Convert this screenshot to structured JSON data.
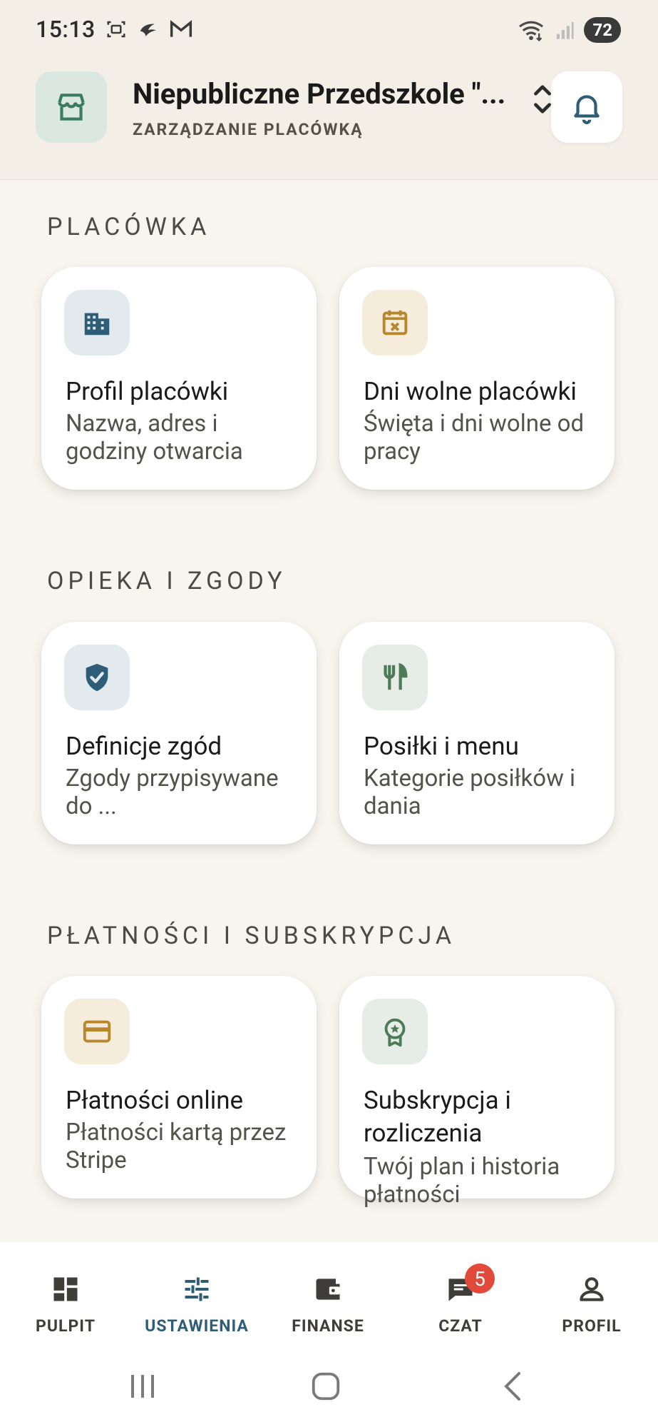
{
  "status_bar": {
    "time": "15:13",
    "battery": "72"
  },
  "header": {
    "institution_name": "Niepubliczne Przedszkole \"...",
    "subtitle": "ZARZĄDZANIE PLACÓWKĄ"
  },
  "sections": [
    {
      "title": "PLACÓWKA",
      "cards": [
        {
          "title": "Profil placówki",
          "desc": "Nazwa, adres i godziny otwarcia",
          "icon": "building-icon"
        },
        {
          "title": "Dni wolne placówki",
          "desc": "Święta i dni wolne od pracy",
          "icon": "calendar-x-icon"
        }
      ]
    },
    {
      "title": "OPIEKA I ZGODY",
      "cards": [
        {
          "title": "Definicje zgód",
          "desc": "Zgody przypisywane do ...",
          "icon": "shield-check-icon"
        },
        {
          "title": "Posiłki i menu",
          "desc": "Kategorie posiłków i dania",
          "icon": "utensils-icon"
        }
      ]
    },
    {
      "title": "PŁATNOŚCI I SUBSKRYPCJA",
      "cards": [
        {
          "title": "Płatności online",
          "desc": "Płatności kartą przez Stripe",
          "icon": "credit-card-icon"
        },
        {
          "title": "Subskrypcja i rozliczenia",
          "desc": "Twój plan i historia płatności",
          "icon": "award-icon"
        }
      ]
    }
  ],
  "bottom_nav": {
    "items": [
      {
        "label": "PULPIT",
        "icon": "dashboard-icon"
      },
      {
        "label": "USTAWIENIA",
        "icon": "sliders-icon",
        "active": true
      },
      {
        "label": "FINANSE",
        "icon": "wallet-icon"
      },
      {
        "label": "CZAT",
        "icon": "chat-icon",
        "badge": "5"
      },
      {
        "label": "PROFIL",
        "icon": "person-icon"
      }
    ]
  },
  "colors": {
    "background": "#f8f5ef",
    "active_nav": "#2f5d78",
    "badge": "#e14a3b",
    "icon_blue": "#2f5d78",
    "icon_tan": "#b8862b",
    "icon_green": "#4f7a58"
  }
}
